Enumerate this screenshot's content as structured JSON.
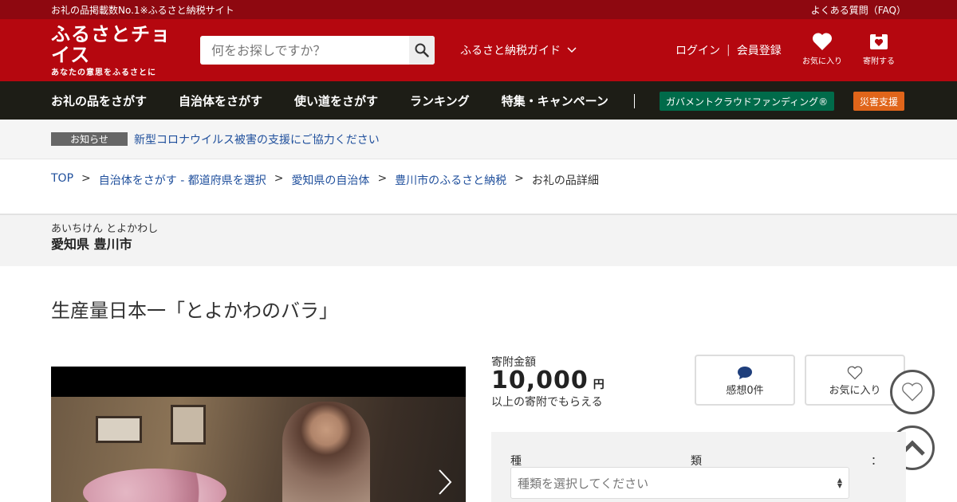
{
  "topbar": {
    "tagline": "お礼の品掲載数No.1※ふるさと納税サイト",
    "faq": "よくある質問（FAQ）"
  },
  "header": {
    "logo_main": "ふるさとチョイス",
    "logo_sub": "あなたの意思をふるさとに",
    "search_placeholder": "何をお探しですか？",
    "guide": "ふるさと納税ガイド",
    "login": "ログイン",
    "register": "会員登録",
    "favorites": "お気に入り",
    "donate": "寄附する"
  },
  "nav": {
    "items": [
      "お礼の品をさがす",
      "自治体をさがす",
      "使い道をさがす",
      "ランキング",
      "特集・キャンペーン"
    ],
    "gcf": "ガバメントクラウドファンディング®",
    "disaster": "災害支援"
  },
  "notice": {
    "tag": "お知らせ",
    "text": "新型コロナウイルス被害の支援にご協力ください"
  },
  "breadcrumb": {
    "items": [
      "TOP",
      "自治体をさがす - 都道府県を選択",
      "愛知県の自治体",
      "豊川市のふるさと納税"
    ],
    "current": "お礼の品詳細",
    "separator": ">"
  },
  "municipality": {
    "kana": "あいちけん とよかわし",
    "name": "愛知県 豊川市"
  },
  "product": {
    "title": "生産量日本一「とよかわのバラ」",
    "price_label": "寄附金額",
    "price": "10,000",
    "price_unit": "円",
    "price_note": "以上の寄附でもらえる",
    "reviews": "感想0件",
    "favorite": "お気に入り",
    "option_label_chars": [
      "種",
      "類",
      "："
    ],
    "option_placeholder": "種類を選択してください"
  },
  "colors": {
    "brand_red": "#b5070f",
    "topbar_red": "#8e0810",
    "nav_dark": "#1d1d16",
    "link_blue": "#1f4f9c",
    "gcf_green": "#006b4a",
    "disaster_orange": "#e0651a"
  }
}
